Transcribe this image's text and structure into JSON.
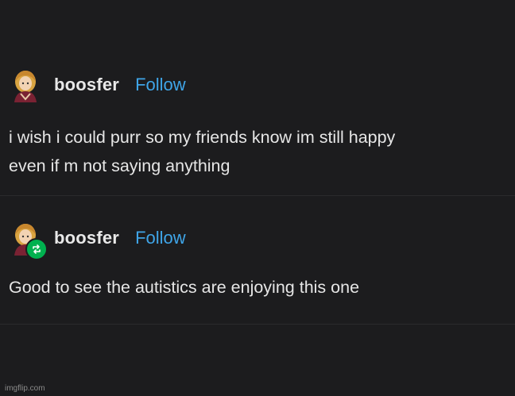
{
  "post1": {
    "username": "boosfer",
    "follow_label": "Follow",
    "text_line1": "i wish i could purr so my friends know im still happy",
    "text_line2": "even if m not saying anything"
  },
  "post2": {
    "username": "boosfer",
    "follow_label": "Follow",
    "text": "Good to see the autistics are enjoying this one"
  },
  "watermark": "imgflip.com",
  "icons": {
    "avatar": "avatar-illustration",
    "reblog": "reblog-icon"
  },
  "colors": {
    "background": "#1c1c1e",
    "follow": "#3fa5e8",
    "reblog_badge": "#00b14f"
  }
}
